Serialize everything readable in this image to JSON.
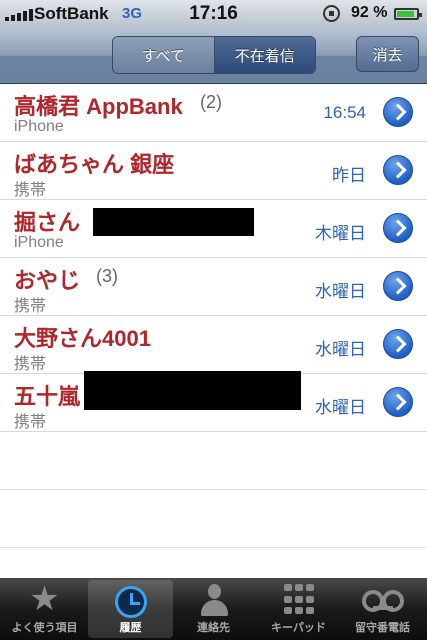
{
  "status_bar": {
    "carrier": "SoftBank",
    "network": "3G",
    "time": "17:16",
    "battery_text": "92 %",
    "battery_level": 0.92
  },
  "nav": {
    "segments": [
      "すべて",
      "不在着信"
    ],
    "selected_segment": "不在着信",
    "clear_label": "消去"
  },
  "calls": [
    {
      "name": "高橋君 AppBank",
      "count": "(2)",
      "type": "iPhone",
      "when": "16:54"
    },
    {
      "name": "ばあちゃん 銀座",
      "count": "",
      "type": "携帯",
      "when": "昨日"
    },
    {
      "name": "掘さん",
      "count": "",
      "type": "iPhone",
      "when": "木曜日"
    },
    {
      "name": "おやじ",
      "count": "(3)",
      "type": "携帯",
      "when": "水曜日"
    },
    {
      "name": "大野さん4001",
      "count": "",
      "type": "携帯",
      "when": "水曜日"
    },
    {
      "name": "五十嵐",
      "count": "",
      "type": "携帯",
      "when": "水曜日"
    }
  ],
  "tabbar": {
    "items": [
      {
        "label": "よく使う項目",
        "icon": "star-icon"
      },
      {
        "label": "履歴",
        "icon": "clock-icon"
      },
      {
        "label": "連絡先",
        "icon": "contacts-icon"
      },
      {
        "label": "キーパッド",
        "icon": "keypad-icon"
      },
      {
        "label": "留守番電話",
        "icon": "voicemail-icon"
      }
    ],
    "selected": "履歴"
  },
  "colors": {
    "name": "#b0262a",
    "time": "#2f63b5",
    "nav": "#6d84a3",
    "accent": "#1f5fc7"
  }
}
